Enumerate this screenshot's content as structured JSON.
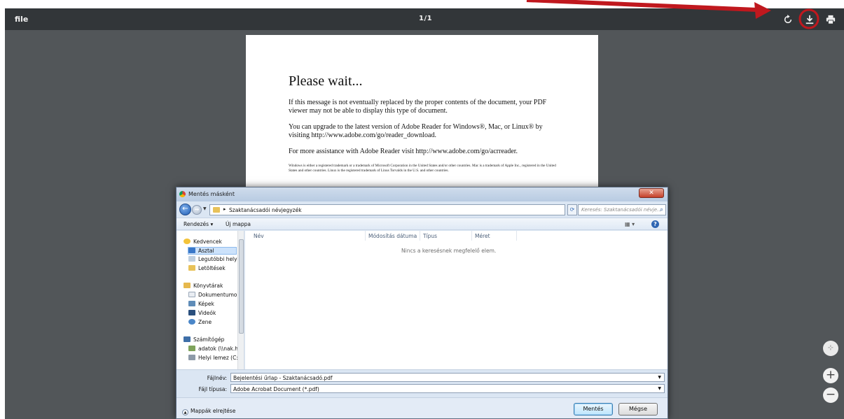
{
  "viewer": {
    "title": "file",
    "page_indicator": "1/1",
    "zoom_in": "+",
    "zoom_out": "−"
  },
  "pdf": {
    "heading": "Please wait...",
    "p1": "If this message is not eventually replaced by the proper contents of the document, your PDF viewer may not be able to display this type of document.",
    "p2": "You can upgrade to the latest version of Adobe Reader for Windows®, Mac, or Linux® by visiting  http://www.adobe.com/go/reader_download.",
    "p3": "For more assistance with Adobe Reader visit  http://www.adobe.com/go/acrreader.",
    "fine_print": "Windows is either a registered trademark or a trademark of Microsoft Corporation in the United States and/or other countries. Mac is a trademark of Apple Inc., registered in the United States and other countries. Linux is the registered trademark of Linus Torvalds in the U.S. and other countries."
  },
  "annotation": {
    "color": "#c0181e"
  },
  "dialog": {
    "title": "Mentés másként",
    "address": "Szaktanácsadói névjegyzék",
    "search_placeholder": "Keresés: Szaktanácsadói névje...",
    "organize": "Rendezés ▾",
    "new_folder": "Új mappa",
    "nav_items": [
      {
        "label": "Kedvencek",
        "icon": "star-icon"
      },
      {
        "label": "Asztal",
        "icon": "desktop-icon"
      },
      {
        "label": "Legutóbbi helye",
        "icon": "recent-places-icon"
      },
      {
        "label": "Letöltések",
        "icon": "downloads-icon"
      },
      {
        "label": "Könyvtárak",
        "icon": "libraries-icon"
      },
      {
        "label": "Dokumentumol",
        "icon": "documents-icon"
      },
      {
        "label": "Képek",
        "icon": "pictures-icon"
      },
      {
        "label": "Videók",
        "icon": "videos-icon"
      },
      {
        "label": "Zene",
        "icon": "music-icon"
      },
      {
        "label": "Számítógép",
        "icon": "computer-icon"
      },
      {
        "label": "adatok (\\\\nak.h",
        "icon": "network-drive-icon"
      },
      {
        "label": "Helyi lemez (C:)",
        "icon": "local-disk-icon"
      }
    ],
    "columns": [
      "Név",
      "Módosítás dátuma",
      "Típus",
      "Méret"
    ],
    "empty_message": "Nincs a keresésnek megfelelő elem.",
    "filename_label": "Fájlnév:",
    "filename_value": "Bejelentési űrlap - Szaktanácsadó.pdf",
    "filetype_label": "Fájl típusa:",
    "filetype_value": "Adobe Acrobat Document (*.pdf)",
    "hide_folders": "Mappák elrejtése",
    "save": "Mentés",
    "cancel": "Mégse"
  }
}
